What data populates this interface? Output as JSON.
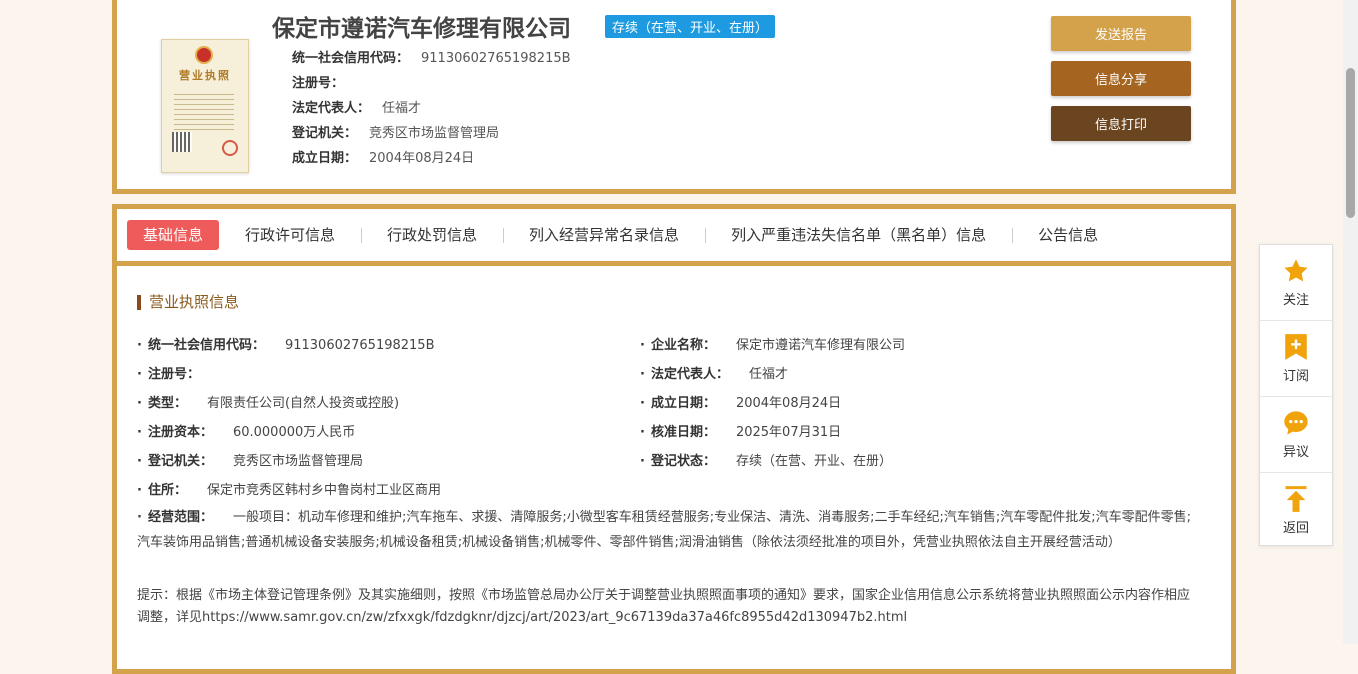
{
  "company": {
    "name": "保定市遵诺汽车修理有限公司",
    "status": "存续（在营、开业、在册）",
    "license_image": {
      "title": "营业执照"
    }
  },
  "top_fields": [
    {
      "label": "统一社会信用代码：",
      "value": "91130602765198215B"
    },
    {
      "label": "注册号：",
      "value": ""
    },
    {
      "label": "法定代表人：",
      "value": "任福才"
    },
    {
      "label": "登记机关：",
      "value": "竞秀区市场监督管理局"
    },
    {
      "label": "成立日期：",
      "value": "2004年08月24日"
    }
  ],
  "actions": {
    "send_report": "发送报告",
    "share": "信息分享",
    "print": "信息打印"
  },
  "colors": {
    "border": "#d4a24a",
    "send_report": "#d4a24a",
    "share": "#a5641f",
    "print": "#6b4420",
    "active_tab": "#ef5b5b",
    "status_badge": "#1e9be0",
    "side_icon": "#f0a30a"
  },
  "tabs": [
    {
      "label": "基础信息",
      "active": true
    },
    {
      "label": "行政许可信息"
    },
    {
      "label": "行政处罚信息"
    },
    {
      "label": "列入经营异常名录信息"
    },
    {
      "label": "列入严重违法失信名单（黑名单）信息"
    },
    {
      "label": "公告信息"
    }
  ],
  "section": {
    "title": "营业执照信息"
  },
  "fields_left": [
    {
      "label": "统一社会信用代码：",
      "value": "91130602765198215B"
    },
    {
      "label": "注册号：",
      "value": ""
    },
    {
      "label": "类型：",
      "value": "有限责任公司(自然人投资或控股)"
    },
    {
      "label": "注册资本：",
      "value": "60.000000万人民币"
    },
    {
      "label": "登记机关：",
      "value": "竞秀区市场监督管理局"
    },
    {
      "label": "住所：",
      "value": "保定市竞秀区韩村乡中鲁岗村工业区商用"
    }
  ],
  "fields_right": [
    {
      "label": "企业名称：",
      "value": "保定市遵诺汽车修理有限公司"
    },
    {
      "label": "法定代表人：",
      "value": "任福才"
    },
    {
      "label": "成立日期：",
      "value": "2004年08月24日"
    },
    {
      "label": "核准日期：",
      "value": "2025年07月31日"
    },
    {
      "label": "登记状态：",
      "value": "存续（在营、开业、在册）"
    }
  ],
  "scope": {
    "label": "经营范围：",
    "value": "一般项目：机动车修理和维护;汽车拖车、求援、清障服务;小微型客车租赁经营服务;专业保洁、清洗、消毒服务;二手车经纪;汽车销售;汽车零配件批发;汽车零配件零售;汽车装饰用品销售;普通机械设备安装服务;机械设备租赁;机械设备销售;机械零件、零部件销售;润滑油销售（除依法须经批准的项目外，凭营业执照依法自主开展经营活动）"
  },
  "notice": "提示：根据《市场主体登记管理条例》及其实施细则，按照《市场监管总局办公厅关于调整营业执照照面事项的通知》要求，国家企业信用信息公示系统将营业执照照面公示内容作相应调整，详见https://www.samr.gov.cn/zw/zfxxgk/fdzdgknr/djzcj/art/2023/art_9c67139da37a46fc8955d42d130947b2.html",
  "side_panel": [
    {
      "label": "关注",
      "icon": "star-icon"
    },
    {
      "label": "订阅",
      "icon": "subscribe-icon"
    },
    {
      "label": "异议",
      "icon": "chat-icon"
    },
    {
      "label": "返回",
      "icon": "back-to-top-icon"
    }
  ]
}
